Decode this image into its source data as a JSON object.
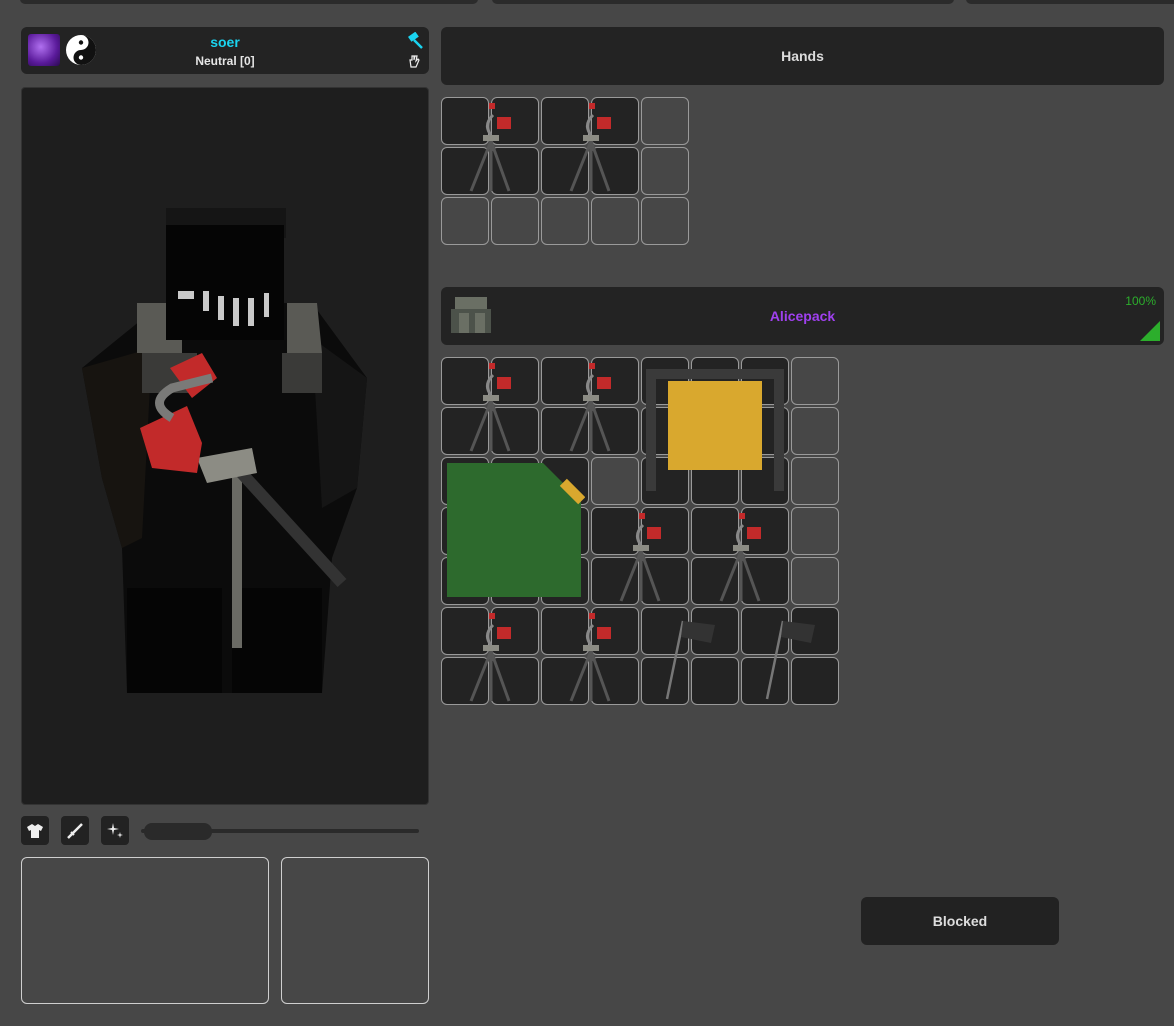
{
  "character": {
    "name": "soer",
    "reputation": "Neutral [0]",
    "skill_icon": "purple-skill-icon",
    "rep_icon": "yin-yang-icon",
    "build_icon": "hammer-icon",
    "gesture_icon": "hand-icon"
  },
  "preview": {
    "model": "hooded-character-with-tripod-turret"
  },
  "toolbar": {
    "items": [
      "clothing-icon",
      "weapon-icon",
      "sparkle-icon"
    ]
  },
  "slider": {
    "level": 0.2
  },
  "hands": {
    "label": "Hands",
    "grid_cols": 5,
    "grid_rows": 3
  },
  "backpack": {
    "name": "Alicepack",
    "quality": "100%",
    "grid_cols": 8,
    "grid_rows": 7
  },
  "status": {
    "blocked_label": "Blocked"
  },
  "colors": {
    "name": "#1ad4f0",
    "backpack_name": "#a040f0",
    "quality": "#2cae2c",
    "panel": "#232323",
    "background": "#474747"
  }
}
